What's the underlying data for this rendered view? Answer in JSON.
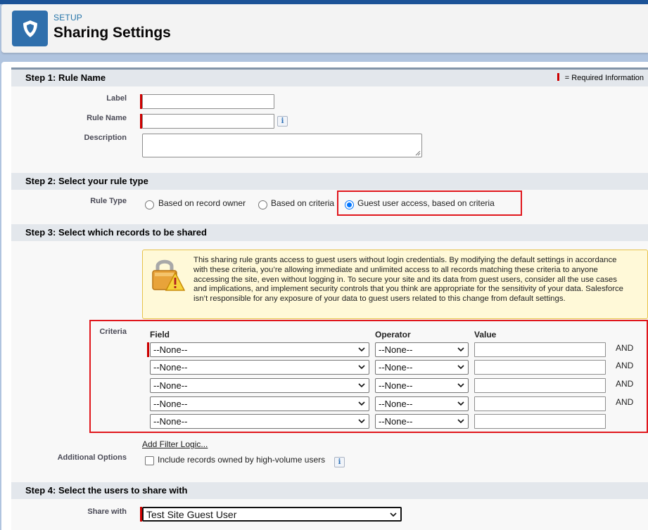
{
  "header": {
    "eyebrow": "SETUP",
    "title": "Sharing Settings",
    "icon": "shield-icon"
  },
  "required_legend": "= Required Information",
  "step1": {
    "heading": "Step 1: Rule Name",
    "label_label": "Label",
    "label_value": "",
    "rule_name_label": "Rule Name",
    "rule_name_value": "",
    "description_label": "Description",
    "description_value": ""
  },
  "step2": {
    "heading": "Step 2: Select your rule type",
    "rule_type_label": "Rule Type",
    "options": [
      {
        "label": "Based on record owner",
        "selected": false
      },
      {
        "label": "Based on criteria",
        "selected": false
      },
      {
        "label": "Guest user access, based on criteria",
        "selected": true
      }
    ]
  },
  "step3": {
    "heading": "Step 3: Select which records to be shared",
    "warning": "This sharing rule grants access to guest users without login credentials. By modifying the default settings in accordance with these criteria, you’re allowing immediate and unlimited access to all records matching these criteria to anyone accessing the site, even without logging in. To secure your site and its data from guest users, consider all the use cases and implications, and implement security controls that you think are appropriate for the sensitivity of your data. Salesforce isn’t responsible for any exposure of your data to guest users related to this change from default settings.",
    "criteria_label": "Criteria",
    "columns": {
      "field": "Field",
      "operator": "Operator",
      "value": "Value"
    },
    "rows": [
      {
        "field": "--None--",
        "operator": "--None--",
        "value": "",
        "conj": "AND"
      },
      {
        "field": "--None--",
        "operator": "--None--",
        "value": "",
        "conj": "AND"
      },
      {
        "field": "--None--",
        "operator": "--None--",
        "value": "",
        "conj": "AND"
      },
      {
        "field": "--None--",
        "operator": "--None--",
        "value": "",
        "conj": "AND"
      },
      {
        "field": "--None--",
        "operator": "--None--",
        "value": "",
        "conj": ""
      }
    ],
    "filter_logic_link": "Add Filter Logic...",
    "additional_options_label": "Additional Options",
    "include_high_volume_label": "Include records owned by high-volume users",
    "include_high_volume_checked": false
  },
  "step4": {
    "heading": "Step 4: Select the users to share with",
    "share_with_label": "Share with",
    "share_with_value": "Test Site Guest User"
  },
  "colors": {
    "accent": "#2f6fac",
    "required": "#cc0000",
    "highlight": "#e0161c",
    "radio_selected": "#0075ff"
  }
}
